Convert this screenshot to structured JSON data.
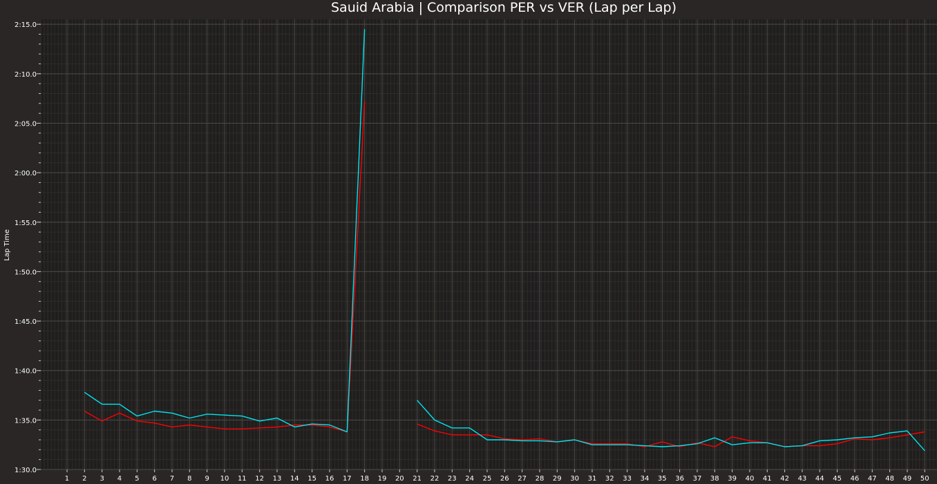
{
  "chart_data": {
    "type": "line",
    "title": "Sauid Arabia | Comparison PER vs VER (Lap per Lap)",
    "xlabel": "",
    "ylabel": "Lap Time",
    "xlim": [
      -0.5,
      50.7
    ],
    "ylim": [
      90,
      135.5
    ],
    "x_ticks": [
      1,
      2,
      3,
      4,
      5,
      6,
      7,
      8,
      9,
      10,
      11,
      12,
      13,
      14,
      15,
      16,
      17,
      18,
      19,
      20,
      21,
      22,
      23,
      24,
      25,
      26,
      27,
      28,
      29,
      30,
      31,
      32,
      33,
      34,
      35,
      36,
      37,
      38,
      39,
      40,
      41,
      42,
      43,
      44,
      45,
      46,
      47,
      48,
      49,
      50
    ],
    "y_ticks": [
      {
        "value": 90,
        "label": "1:30.0"
      },
      {
        "value": 95,
        "label": "1:35.0"
      },
      {
        "value": 100,
        "label": "1:40.0"
      },
      {
        "value": 105,
        "label": "1:45.0"
      },
      {
        "value": 110,
        "label": "1:50.0"
      },
      {
        "value": 115,
        "label": "1:55.0"
      },
      {
        "value": 120,
        "label": "2:00.0"
      },
      {
        "value": 125,
        "label": "2:05.0"
      },
      {
        "value": 130,
        "label": "2:10.0"
      },
      {
        "value": 135,
        "label": "2:15.0"
      }
    ],
    "grid": true,
    "legend": "none",
    "series": [
      {
        "color": "#ff0000",
        "points": [
          [
            2,
            95.9
          ],
          [
            3,
            94.9
          ],
          [
            4,
            95.7
          ],
          [
            5,
            94.9
          ],
          [
            6,
            94.7
          ],
          [
            7,
            94.3
          ],
          [
            8,
            94.5
          ],
          [
            9,
            94.3
          ],
          [
            10,
            94.1
          ],
          [
            11,
            94.1
          ],
          [
            12,
            94.2
          ],
          [
            13,
            94.3
          ],
          [
            14,
            94.5
          ],
          [
            15,
            94.5
          ],
          [
            16,
            94.3
          ],
          [
            17,
            93.8
          ],
          [
            18,
            127.2
          ],
          null,
          [
            21,
            94.6
          ],
          [
            22,
            93.9
          ],
          [
            23,
            93.5
          ],
          [
            24,
            93.5
          ],
          [
            25,
            93.5
          ],
          [
            26,
            93.1
          ],
          [
            27,
            93.0
          ],
          [
            28,
            93.1
          ],
          [
            29,
            92.8
          ],
          [
            30,
            93.0
          ],
          [
            31,
            92.6
          ],
          [
            32,
            92.6
          ],
          [
            33,
            92.6
          ],
          [
            34,
            92.3
          ],
          [
            35,
            92.8
          ],
          [
            36,
            92.3
          ],
          [
            37,
            92.7
          ],
          [
            38,
            92.3
          ],
          [
            39,
            93.3
          ],
          [
            40,
            92.9
          ],
          [
            41,
            92.7
          ],
          [
            42,
            92.3
          ],
          [
            43,
            92.4
          ],
          [
            44,
            92.4
          ],
          [
            45,
            92.6
          ],
          [
            46,
            93.1
          ],
          [
            47,
            93.0
          ],
          [
            48,
            93.2
          ],
          [
            49,
            93.5
          ],
          [
            50,
            93.8
          ]
        ]
      },
      {
        "color": "#00e5ee",
        "points": [
          [
            2,
            97.8
          ],
          [
            3,
            96.6
          ],
          [
            4,
            96.6
          ],
          [
            5,
            95.4
          ],
          [
            6,
            95.9
          ],
          [
            7,
            95.7
          ],
          [
            8,
            95.2
          ],
          [
            9,
            95.6
          ],
          [
            10,
            95.5
          ],
          [
            11,
            95.4
          ],
          [
            12,
            94.9
          ],
          [
            13,
            95.2
          ],
          [
            14,
            94.3
          ],
          [
            15,
            94.6
          ],
          [
            16,
            94.5
          ],
          [
            17,
            93.8
          ],
          [
            18,
            134.5
          ],
          null,
          [
            21,
            97.0
          ],
          [
            22,
            95.0
          ],
          [
            23,
            94.2
          ],
          [
            24,
            94.2
          ],
          [
            25,
            93.0
          ],
          [
            26,
            93.0
          ],
          [
            27,
            92.9
          ],
          [
            28,
            92.9
          ],
          [
            29,
            92.8
          ],
          [
            30,
            93.0
          ],
          [
            31,
            92.5
          ],
          [
            32,
            92.5
          ],
          [
            33,
            92.5
          ],
          [
            34,
            92.4
          ],
          [
            35,
            92.3
          ],
          [
            36,
            92.4
          ],
          [
            37,
            92.6
          ],
          [
            38,
            93.2
          ],
          [
            39,
            92.5
          ],
          [
            40,
            92.7
          ],
          [
            41,
            92.7
          ],
          [
            42,
            92.3
          ],
          [
            43,
            92.4
          ],
          [
            44,
            92.9
          ],
          [
            45,
            93.0
          ],
          [
            46,
            93.2
          ],
          [
            47,
            93.3
          ],
          [
            48,
            93.7
          ],
          [
            49,
            93.9
          ],
          [
            50,
            91.9
          ]
        ]
      }
    ]
  }
}
